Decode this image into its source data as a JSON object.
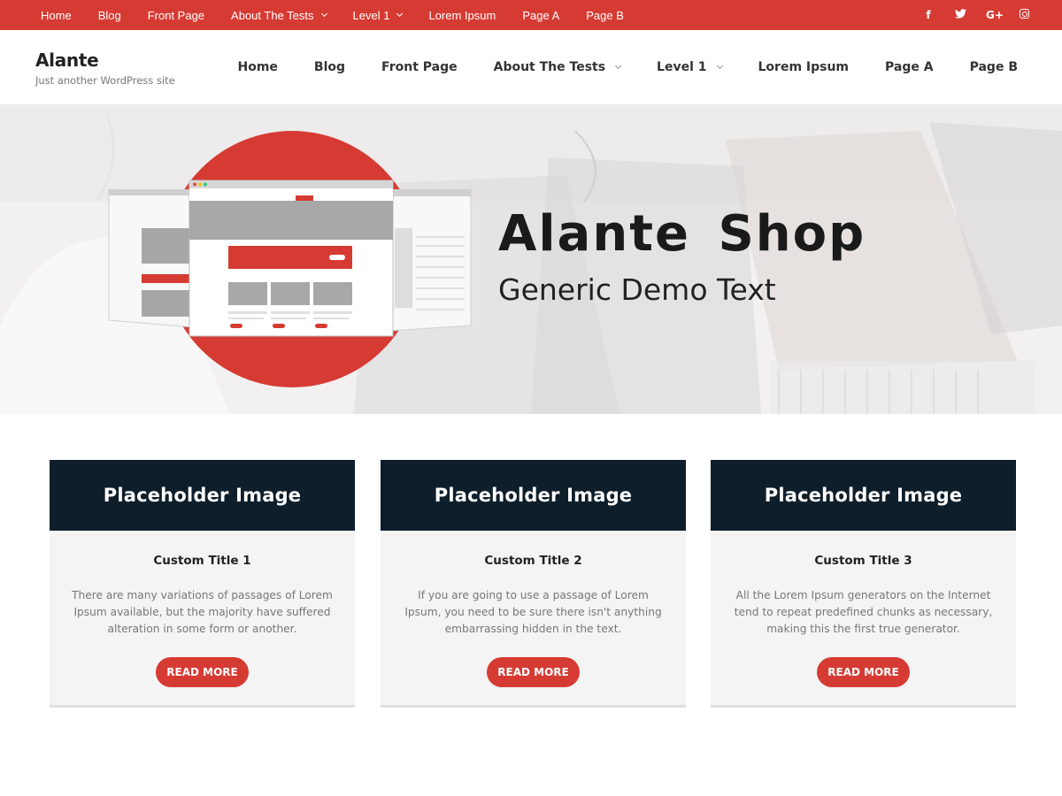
{
  "topbar": {
    "nav": [
      {
        "label": "Home",
        "dropdown": false
      },
      {
        "label": "Blog",
        "dropdown": false
      },
      {
        "label": "Front Page",
        "dropdown": false
      },
      {
        "label": "About The Tests",
        "dropdown": true
      },
      {
        "label": "Level 1",
        "dropdown": true
      },
      {
        "label": "Lorem Ipsum",
        "dropdown": false
      },
      {
        "label": "Page A",
        "dropdown": false
      },
      {
        "label": "Page B",
        "dropdown": false
      }
    ],
    "social": [
      {
        "icon": "facebook-icon",
        "glyph": "f"
      },
      {
        "icon": "twitter-icon",
        "glyph": "ᶮ"
      },
      {
        "icon": "google-plus-icon",
        "glyph": "G+"
      },
      {
        "icon": "instagram-icon",
        "glyph": ""
      }
    ],
    "color": "#d63b33"
  },
  "header": {
    "site_title": "Alante",
    "tagline": "Just another WordPress site",
    "nav": [
      {
        "label": "Home",
        "dropdown": false
      },
      {
        "label": "Blog",
        "dropdown": false
      },
      {
        "label": "Front Page",
        "dropdown": false
      },
      {
        "label": "About The Tests",
        "dropdown": true
      },
      {
        "label": "Level 1",
        "dropdown": true
      },
      {
        "label": "Lorem Ipsum",
        "dropdown": false
      },
      {
        "label": "Page A",
        "dropdown": false
      },
      {
        "label": "Page B",
        "dropdown": false
      }
    ]
  },
  "hero": {
    "title": "Alante  Shop",
    "subtitle": "Generic Demo Text",
    "accent": "#d63b33"
  },
  "cards": [
    {
      "image_label": "Placeholder Image",
      "title": "Custom Title 1",
      "text": "There are many variations of passages of Lorem Ipsum available, but the majority have suffered alteration in some form or another.",
      "button": "READ MORE"
    },
    {
      "image_label": "Placeholder Image",
      "title": "Custom Title 2",
      "text": "If you are going to use a passage of Lorem Ipsum, you need to be sure there isn't anything embarrassing hidden in the text.",
      "button": "READ MORE"
    },
    {
      "image_label": "Placeholder Image",
      "title": "Custom Title 3",
      "text": "All the Lorem Ipsum generators on the Internet tend to repeat predefined chunks as necessary, making this the first true generator.",
      "button": "READ MORE"
    }
  ]
}
